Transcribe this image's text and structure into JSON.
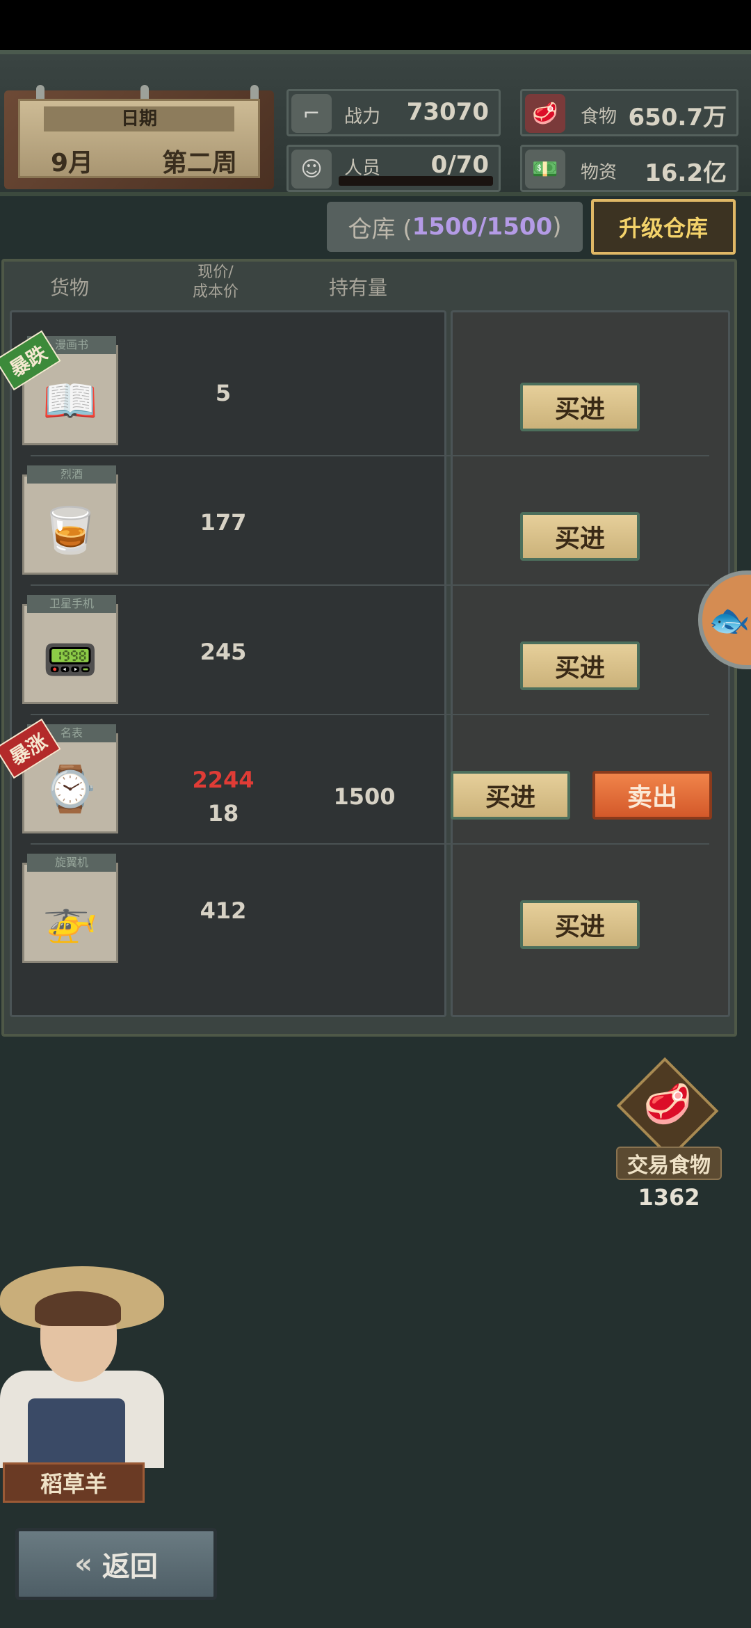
{
  "header": {
    "date_label": "日期",
    "month": "9月",
    "week": "第二周",
    "combat_label": "战力",
    "combat_value": "73070",
    "staff_label": "人员",
    "staff_value": "0/70",
    "food_label": "食物",
    "food_value": "650.7万",
    "supplies_label": "物资",
    "supplies_value": "16.2亿"
  },
  "warehouse": {
    "prefix": "仓库 (",
    "capacity": "1500/1500",
    "suffix": ")",
    "upgrade_label": "升级仓库"
  },
  "columns": {
    "goods": "货物",
    "price_line1": "现价/",
    "price_line2": "成本价",
    "holdings": "持有量"
  },
  "rows": [
    {
      "tag": "漫画书",
      "badge": "暴跌",
      "price": "5",
      "cost": "",
      "hold": "",
      "buy": "买进",
      "sell": ""
    },
    {
      "tag": "烈酒",
      "badge": "",
      "price": "177",
      "cost": "",
      "hold": "",
      "buy": "买进",
      "sell": ""
    },
    {
      "tag": "卫星手机",
      "badge": "",
      "price": "245",
      "cost": "",
      "hold": "",
      "buy": "买进",
      "sell": ""
    },
    {
      "tag": "名表",
      "badge": "暴涨",
      "price": "2244",
      "cost": "18",
      "hold": "1500",
      "buy": "买进",
      "sell": "卖出"
    },
    {
      "tag": "旋翼机",
      "badge": "",
      "price": "412",
      "cost": "",
      "hold": "",
      "buy": "买进",
      "sell": ""
    }
  ],
  "trade": {
    "label": "交易食物",
    "count": "1362"
  },
  "npc": {
    "name": "稻草羊"
  },
  "footer": {
    "back_label": "返回"
  }
}
